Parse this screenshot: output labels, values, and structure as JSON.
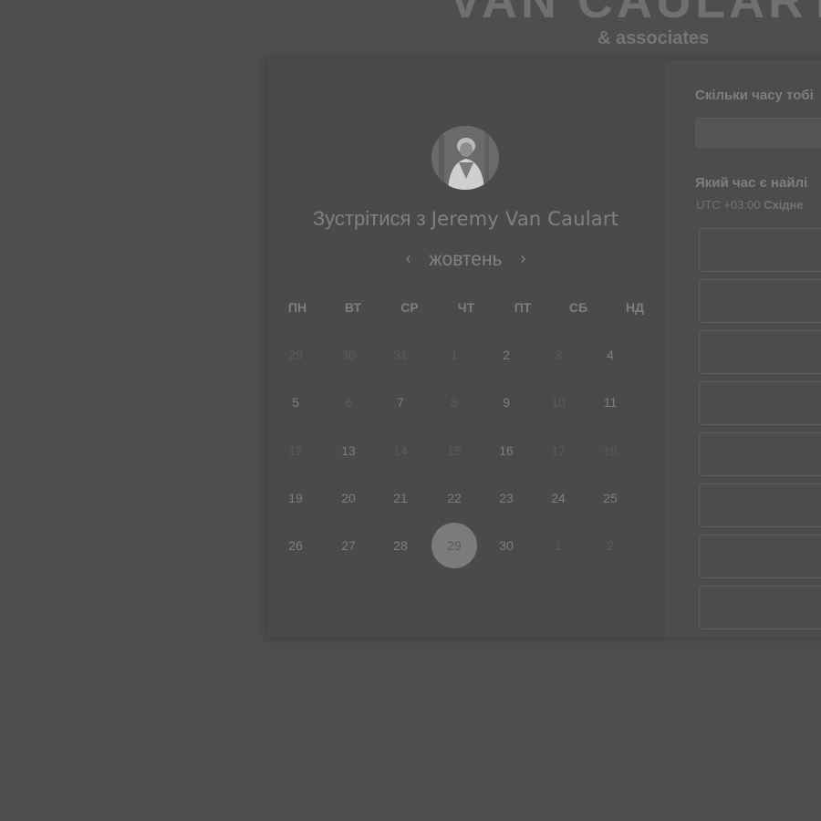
{
  "brand": {
    "title": "VAN CAULART",
    "subtitle": "& associates"
  },
  "left": {
    "meet_prefix": "Зустрітися з",
    "host_name": "Jeremy Van Caulart",
    "month": "жовтень",
    "prev_icon": "chevron-left-icon",
    "next_icon": "chevron-right-icon",
    "weekdays": [
      "ПН",
      "ВТ",
      "СР",
      "ЧТ",
      "ПТ",
      "СБ",
      "НД"
    ],
    "days": [
      [
        "29",
        "30",
        "31",
        "1",
        "2",
        "3",
        "4"
      ],
      [
        "5",
        "6",
        "7",
        "8",
        "9",
        "10",
        "11"
      ],
      [
        "12",
        "13",
        "14",
        "15",
        "16",
        "17",
        "18"
      ],
      [
        "19",
        "20",
        "21",
        "22",
        "23",
        "24",
        "25"
      ],
      [
        "26",
        "27",
        "28",
        "29",
        "30",
        "1",
        "2"
      ]
    ],
    "available": [
      [
        false,
        false,
        false,
        false,
        true,
        false,
        true
      ],
      [
        true,
        false,
        true,
        false,
        true,
        false,
        true
      ],
      [
        false,
        true,
        false,
        false,
        true,
        false,
        false
      ],
      [
        true,
        true,
        true,
        true,
        true,
        true,
        true
      ],
      [
        true,
        true,
        true,
        true,
        true,
        false,
        false
      ]
    ],
    "selected_day": "29"
  },
  "right": {
    "duration_question": "Скільки часу тобі",
    "best_time_question": "Який час є найлі",
    "timezone_offset": "UTC +03:00",
    "timezone_name": "Східне",
    "slot_count": 8
  },
  "colors": {
    "background": "#4e4e4e",
    "selected_day": "#7b7b7b",
    "text": "#7e7e7e",
    "muted_text": "#5a5a5a"
  }
}
